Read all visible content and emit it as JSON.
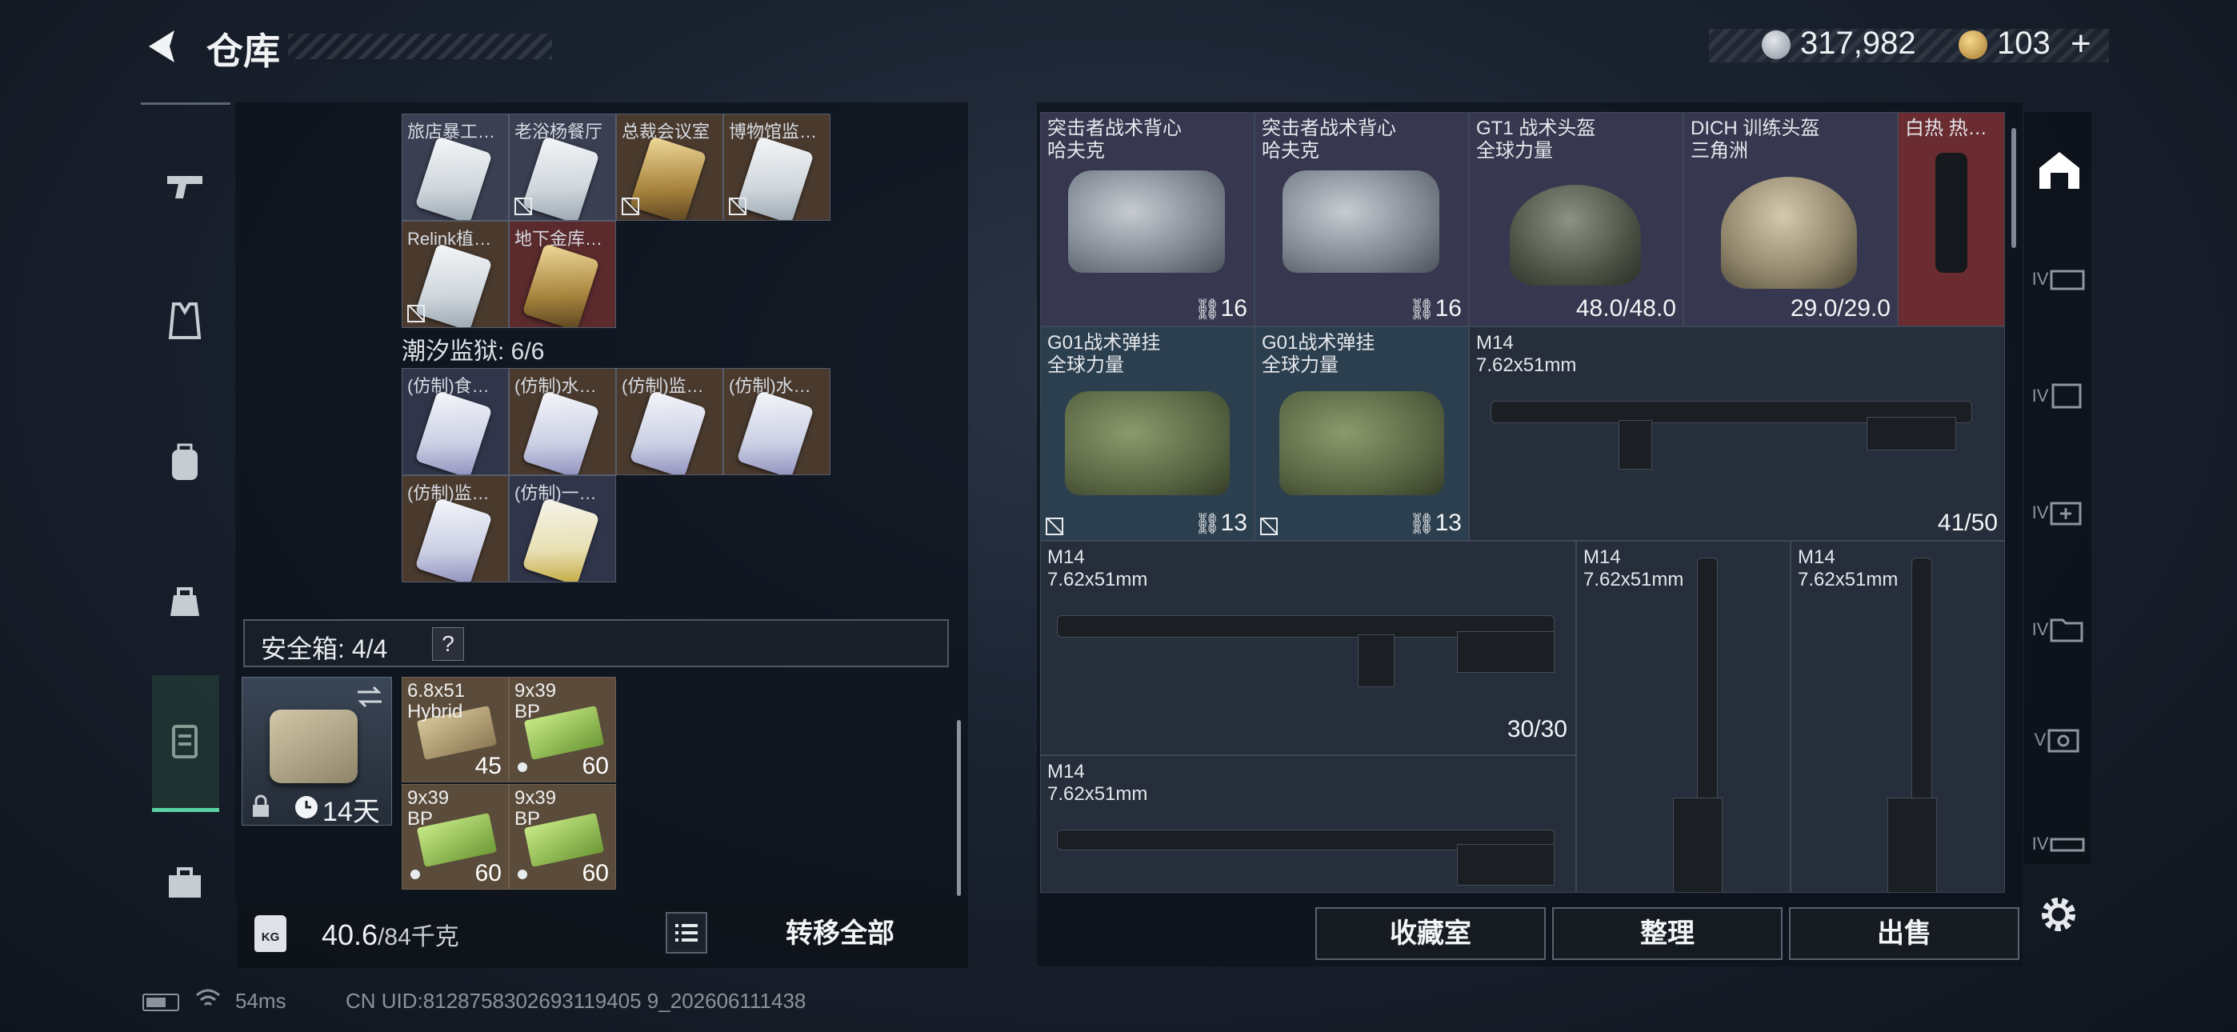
{
  "header": {
    "title": "仓库",
    "currency_1": "317,982",
    "currency_2": "103",
    "currency_2_suffix": "+"
  },
  "sidebar": {
    "items": [
      {
        "icon": "pistol-icon"
      },
      {
        "icon": "vest-icon"
      },
      {
        "icon": "backpack-icon"
      },
      {
        "icon": "bag-icon"
      },
      {
        "icon": "keycard-case-icon",
        "active": true
      },
      {
        "icon": "toolbox-icon"
      }
    ]
  },
  "left": {
    "keycards_top": [
      {
        "label": "旅店暴工…",
        "style": "silver"
      },
      {
        "label": "老浴杨餐厅",
        "style": "silver"
      },
      {
        "label": "总裁会议室",
        "style": "gold"
      },
      {
        "label": "博物馆监…",
        "style": "silver"
      },
      {
        "label": "Relink植…",
        "style": "silver"
      },
      {
        "label": "地下金库…",
        "style": "gold-red"
      }
    ],
    "section_prison": "潮汐监狱: 6/6",
    "keycards_prison": [
      {
        "label": "(仿制)食…"
      },
      {
        "label": "(仿制)水…"
      },
      {
        "label": "(仿制)监…"
      },
      {
        "label": "(仿制)水…"
      },
      {
        "label": "(仿制)监…"
      },
      {
        "label": "(仿制)一…"
      }
    ],
    "safe": {
      "label": "安全箱: 4/4",
      "help": "?",
      "days": "14天"
    },
    "ammo": [
      {
        "line1": "6.8x51",
        "line2": "Hybrid",
        "count": "45"
      },
      {
        "line1": "9x39",
        "line2": "BP",
        "count": "60"
      },
      {
        "line1": "9x39",
        "line2": "BP",
        "count": "60"
      },
      {
        "line1": "9x39",
        "line2": "BP",
        "count": "60"
      }
    ],
    "weight_value": "40.6",
    "weight_max": "/84千克",
    "transfer_label": "转移全部"
  },
  "right": {
    "items": [
      {
        "name": "突击者战术背心",
        "sub": "哈夫克",
        "count": "16"
      },
      {
        "name": "突击者战术背心",
        "sub": "哈夫克",
        "count": "16"
      },
      {
        "name": "GT1 战术头盔",
        "sub": "全球力量",
        "count": "48.0/48.0"
      },
      {
        "name": "DICH 训练头盔",
        "sub": "三角洲",
        "count": "29.0/29.0"
      },
      {
        "name": "白热 热…",
        "sub": "",
        "count": ""
      },
      {
        "name": "G01战术弹挂",
        "sub": "全球力量",
        "count": "13"
      },
      {
        "name": "G01战术弹挂",
        "sub": "全球力量",
        "count": "13"
      },
      {
        "name": "M14",
        "sub": "7.62x51mm",
        "count": "41/50"
      },
      {
        "name": "M14",
        "sub": "7.62x51mm",
        "count": "30/30"
      },
      {
        "name": "M14",
        "sub": "7.62x51mm",
        "count": ""
      },
      {
        "name": "M14",
        "sub": "7.62x51mm",
        "count": ""
      },
      {
        "name": "M14",
        "sub": "7.62x51mm",
        "count": ""
      }
    ],
    "buttons": {
      "collection": "收藏室",
      "sort": "整理",
      "sell": "出售"
    },
    "nav": [
      "IV",
      "IV",
      "IV",
      "IV",
      "V",
      "IV"
    ]
  },
  "status": {
    "ping": "54ms",
    "uid": "CN UID:8128758302693119405 9_202606111438"
  },
  "colors": {
    "accent": "#5ad1a0",
    "panel": "#0c121a"
  }
}
